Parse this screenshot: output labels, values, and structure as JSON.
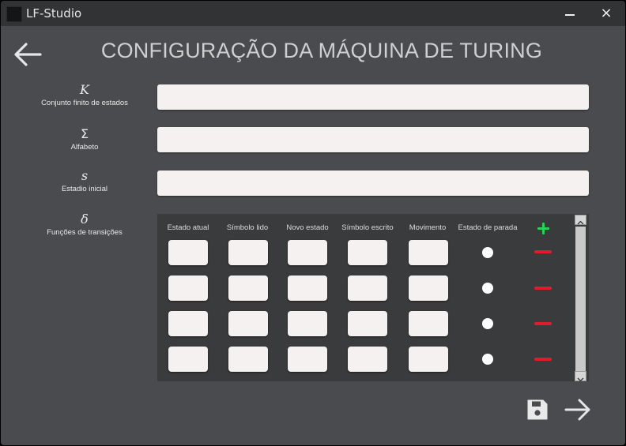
{
  "window": {
    "title": "LF-Studio",
    "minimize_label": "",
    "close_label": "×"
  },
  "header": {
    "title": "CONFIGURAÇÃO DA MÁQUINA DE TURING",
    "back_icon": "arrow-left-icon"
  },
  "fields": {
    "states": {
      "symbol": "K",
      "caption": "Conjunto finito de estados",
      "value": ""
    },
    "alphabet": {
      "symbol": "Σ",
      "caption": "Alfabeto",
      "value": ""
    },
    "initial": {
      "symbol": "s",
      "caption": "Estadio inicial",
      "value": ""
    },
    "transitions": {
      "symbol": "δ",
      "caption": "Funções de transições"
    }
  },
  "transitions_table": {
    "columns": [
      "Estado atual",
      "Símbolo lido",
      "Novo estado",
      "Símbolo escrito",
      "Movimento",
      "Estado de parada"
    ],
    "rows": [
      {
        "estado_atual": "",
        "simbolo_lido": "",
        "novo_estado": "",
        "simbolo_escrito": "",
        "movimento": "",
        "estado_de_parada": false
      },
      {
        "estado_atual": "",
        "simbolo_lido": "",
        "novo_estado": "",
        "simbolo_escrito": "",
        "movimento": "",
        "estado_de_parada": false
      },
      {
        "estado_atual": "",
        "simbolo_lido": "",
        "novo_estado": "",
        "simbolo_escrito": "",
        "movimento": "",
        "estado_de_parada": false
      },
      {
        "estado_atual": "",
        "simbolo_lido": "",
        "novo_estado": "",
        "simbolo_escrito": "",
        "movimento": "",
        "estado_de_parada": false
      }
    ],
    "add_icon": "plus-icon",
    "remove_icon": "minus-icon"
  },
  "footer": {
    "save_icon": "floppy-disk-icon",
    "next_icon": "arrow-right-icon"
  },
  "colors": {
    "background": "#4a4b4e",
    "titlebar": "#323335",
    "input": "#f5f1f0",
    "add": "#28d25a",
    "remove": "#e01b2c"
  }
}
